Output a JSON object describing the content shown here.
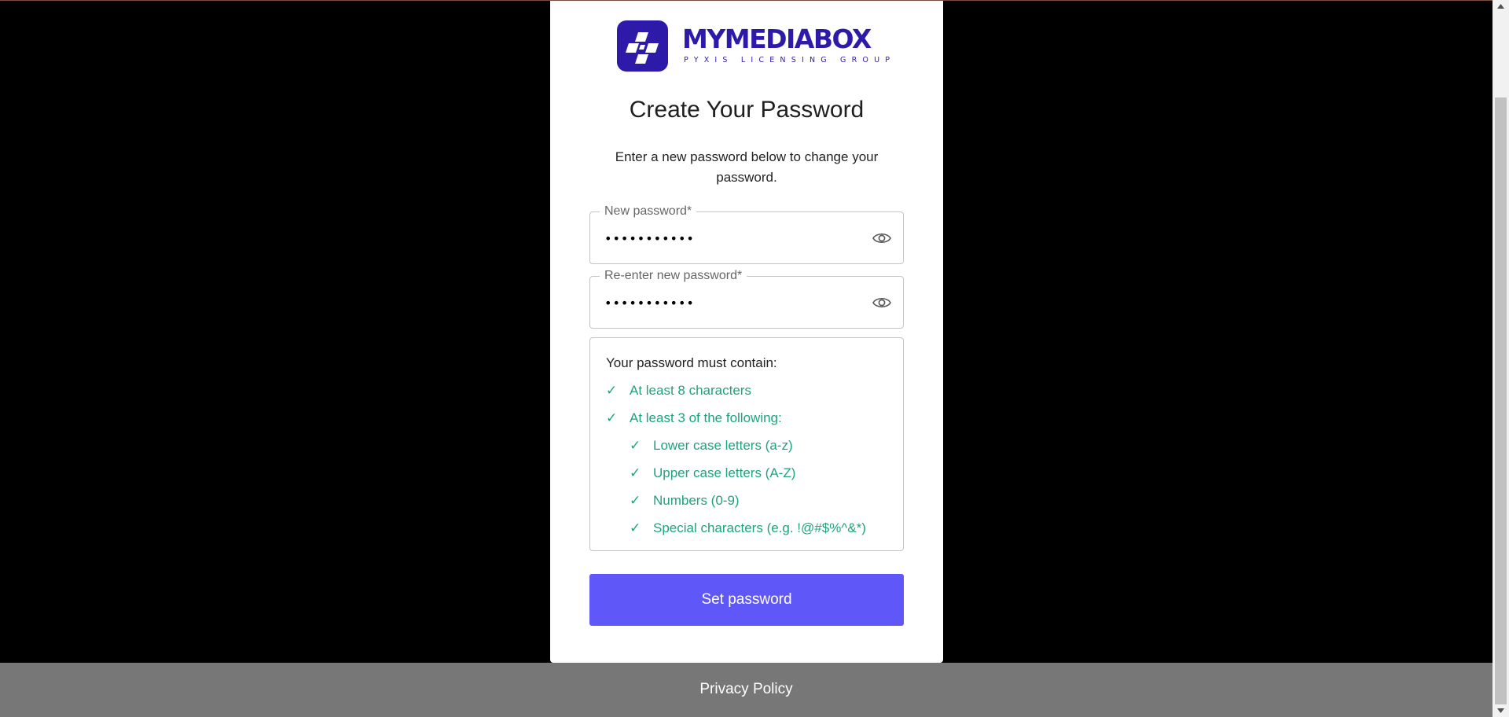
{
  "logo": {
    "name": "MYMEDIABOX",
    "tagline": "PYXIS LICENSING GROUP",
    "brand_color": "#2e1aa8"
  },
  "title": "Create Your Password",
  "subtitle": "Enter a new password below to change your password.",
  "fields": {
    "new_password": {
      "label": "New password*",
      "value": "•••••••••••"
    },
    "confirm_password": {
      "label": "Re-enter new password*",
      "value": "•••••••••••"
    },
    "toggle_icon": "eye-icon"
  },
  "requirements": {
    "heading": "Your password must contain:",
    "check_symbol": "✓",
    "items": [
      {
        "label": "At least 8 characters",
        "met": true
      },
      {
        "label": "At least 3 of the following:",
        "met": true
      },
      {
        "label": "Lower case letters (a-z)",
        "met": true
      },
      {
        "label": "Upper case letters (A-Z)",
        "met": true
      },
      {
        "label": "Numbers (0-9)",
        "met": true
      },
      {
        "label": "Special characters (e.g. !@#$%^&*)",
        "met": true
      }
    ],
    "met_color": "#1fa37d"
  },
  "submit": {
    "label": "Set password",
    "color": "#5f57f7"
  },
  "footer": {
    "link": "Privacy Policy"
  }
}
